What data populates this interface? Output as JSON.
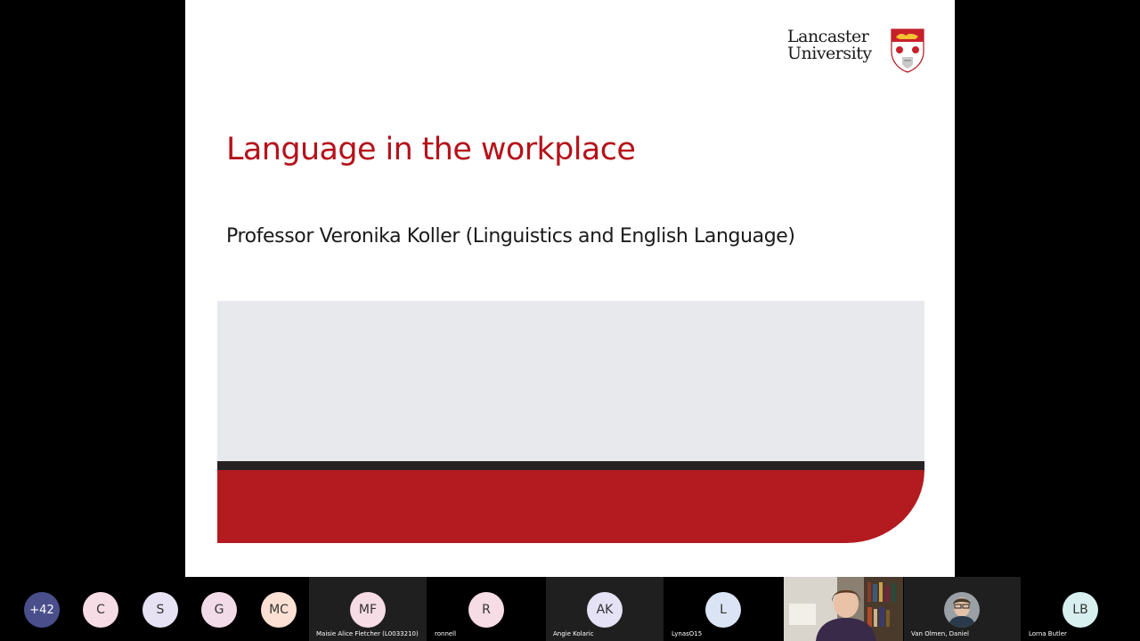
{
  "slide": {
    "logo": {
      "line1": "Lancaster",
      "line2": "University"
    },
    "title": "Language in the workplace",
    "subtitle": "Professor Veronika Koller (Linguistics and English Language)",
    "colors": {
      "title": "#b5121b",
      "banner_grey": "#e8e9ec",
      "banner_dark": "#262223",
      "banner_red": "#b31b20"
    }
  },
  "participants": {
    "overflow_count": "+42",
    "avatars": [
      {
        "initials": "C",
        "color": "#f6dce4"
      },
      {
        "initials": "S",
        "color": "#e6e2f4"
      },
      {
        "initials": "G",
        "color": "#f2dbe9"
      },
      {
        "initials": "MC",
        "color": "#fbe0d3"
      }
    ],
    "tiles": [
      {
        "initials": "MF",
        "name": "Maisie Alice Fletcher (L0033210)",
        "color": "#f6dce4"
      },
      {
        "initials": "R",
        "name": "ronnell",
        "color": "#f6dce4"
      },
      {
        "initials": "AK",
        "name": "Angie Kolaric",
        "color": "#e4e2f4"
      },
      {
        "initials": "L",
        "name": "LynasO15",
        "color": "#dbe4f4"
      },
      {
        "video": true,
        "name": "",
        "icon": "presenter-video-icon"
      },
      {
        "video_avatar": true,
        "name": "Van Olmen, Daniel",
        "icon": "user-photo-icon"
      },
      {
        "initials": "LB",
        "name": "Lorna Butler",
        "color": "#d8efef"
      }
    ]
  }
}
